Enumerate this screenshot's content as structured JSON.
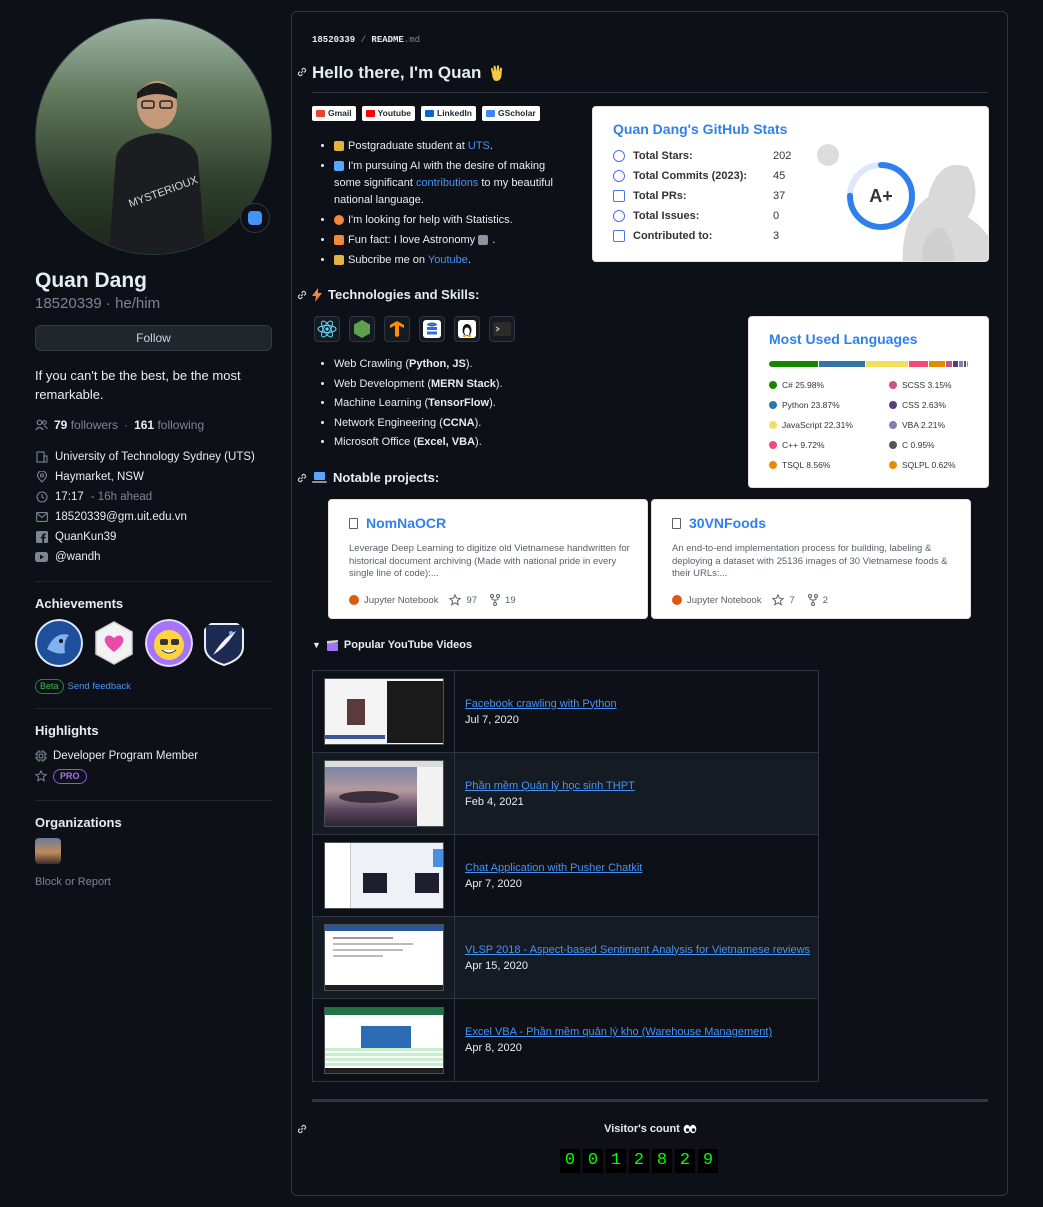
{
  "profile": {
    "name": "Quan Dang",
    "login_pronouns": "18520339 · he/him",
    "follow_label": "Follow",
    "bio": "If you can't be the best, be the most remarkable.",
    "followers_count": "79",
    "followers_label": "followers",
    "following_count": "161",
    "following_label": "following",
    "details": [
      {
        "icon": "organization-icon",
        "text": "University of Technology Sydney (UTS)"
      },
      {
        "icon": "location-icon",
        "text": "Haymarket, NSW"
      },
      {
        "icon": "clock-icon",
        "text": "17:17",
        "extra": "- 16h ahead"
      },
      {
        "icon": "mail-icon",
        "text": "18520339@gm.uit.edu.vn"
      },
      {
        "icon": "facebook-icon",
        "text": "QuanKun39"
      },
      {
        "icon": "youtube-icon",
        "text": "@wandh"
      }
    ],
    "achievements_title": "Achievements",
    "beta_label": "Beta",
    "feedback_label": "Send feedback",
    "highlights_title": "Highlights",
    "highlight_member": "Developer Program Member",
    "pro_label": "PRO",
    "organizations_title": "Organizations",
    "block_label": "Block or Report"
  },
  "readme": {
    "breadcrumb_user": "18520339",
    "breadcrumb_sep": " / ",
    "breadcrumb_file": "README",
    "breadcrumb_ext": ".md",
    "heading": "Hello there, I'm Quan",
    "badges": [
      "Gmail",
      "Youtube",
      "LinkedIn",
      "GScholar"
    ],
    "intro": {
      "b1_pre": "Postgraduate student at ",
      "b1_link": "UTS",
      "b1_post": ".",
      "b2_pre": "I'm pursuing AI with the desire of making some significant ",
      "b2_link": "contributions",
      "b2_post": " to my beautiful national language.",
      "b3": "I'm looking for help with Statistics.",
      "b4_pre": "Fun fact: I love Astronomy",
      "b4_post": ".",
      "b5_pre": "Subcribe me on ",
      "b5_link": "Youtube",
      "b5_post": "."
    },
    "tech_heading": "Technologies and Skills:",
    "skills": [
      {
        "pre": "Web Crawling (",
        "bold": "Python, JS",
        "post": ")."
      },
      {
        "pre": "Web Development (",
        "bold": "MERN Stack",
        "post": ")."
      },
      {
        "pre": "Machine Learning (",
        "bold": "TensorFlow",
        "post": ")."
      },
      {
        "pre": "Network Engineering (",
        "bold": "CCNA",
        "post": ")."
      },
      {
        "pre": "Microsoft Office (",
        "bold": "Excel, VBA",
        "post": ")."
      }
    ],
    "projects_heading": "Notable projects:",
    "videos_heading": "Popular YouTube Videos",
    "videos": [
      {
        "title": "Facebook crawling with Python",
        "date": "Jul 7, 2020"
      },
      {
        "title": "Phần mềm Quản lý học sinh THPT",
        "date": "Feb 4, 2021"
      },
      {
        "title": "Chat Application with Pusher Chatkit",
        "date": "Apr 7, 2020"
      },
      {
        "title": "VLSP 2018 - Aspect-based Sentiment Analysis for Vietnamese reviews",
        "date": "Apr 15, 2020"
      },
      {
        "title": "Excel VBA - Phần mềm quản lý kho (Warehouse Management)",
        "date": "Apr 8, 2020"
      }
    ],
    "visitor_label": "Visitor's count",
    "visitor_digits": [
      "0",
      "0",
      "1",
      "2",
      "8",
      "2",
      "9"
    ]
  },
  "stats_card": {
    "title": "Quan Dang's GitHub Stats",
    "rows": [
      {
        "label": "Total Stars:",
        "value": "202"
      },
      {
        "label": "Total Commits (2023):",
        "value": "45"
      },
      {
        "label": "Total PRs:",
        "value": "37"
      },
      {
        "label": "Total Issues:",
        "value": "0"
      },
      {
        "label": "Contributed to:",
        "value": "3"
      }
    ],
    "rank": "A+",
    "rank_progress": 0.75
  },
  "languages_card": {
    "title": "Most Used Languages",
    "items": [
      {
        "name": "C# 25.98%",
        "percent": 25.98,
        "color": "#178600"
      },
      {
        "name": "Python 23.87%",
        "percent": 23.87,
        "color": "#3572A5"
      },
      {
        "name": "JavaScript 22.31%",
        "percent": 22.31,
        "color": "#f1e05a"
      },
      {
        "name": "C++ 9.72%",
        "percent": 9.72,
        "color": "#f34b7d"
      },
      {
        "name": "TSQL 8.56%",
        "percent": 8.56,
        "color": "#e38c00"
      },
      {
        "name": "SCSS 3.15%",
        "percent": 3.15,
        "color": "#c6538c"
      },
      {
        "name": "CSS 2.63%",
        "percent": 2.63,
        "color": "#563d7c"
      },
      {
        "name": "VBA 2.21%",
        "percent": 2.21,
        "color": "#867db1"
      },
      {
        "name": "C 0.95%",
        "percent": 0.95,
        "color": "#555555"
      },
      {
        "name": "SQLPL 0.62%",
        "percent": 0.62,
        "color": "#e38c00"
      }
    ]
  },
  "projects": [
    {
      "name": "NomNaOCR",
      "description": "Leverage Deep Learning to digitize old Vietnamese handwritten for historical document archiving (Made with national pride in every single line of code):...",
      "language": "Jupyter Notebook",
      "stars": "97",
      "forks": "19"
    },
    {
      "name": "30VNFoods",
      "description": "An end-to-end implementation process for building, labeling & deploying a dataset with 25136 images of 30 Vietnamese foods & their URLs:...",
      "language": "Jupyter Notebook",
      "stars": "7",
      "forks": "2"
    }
  ],
  "colors": {
    "background": "#0d1117",
    "link": "#4493f8",
    "card_title": "#2f80ed",
    "counter_digit": "#00ff00"
  }
}
